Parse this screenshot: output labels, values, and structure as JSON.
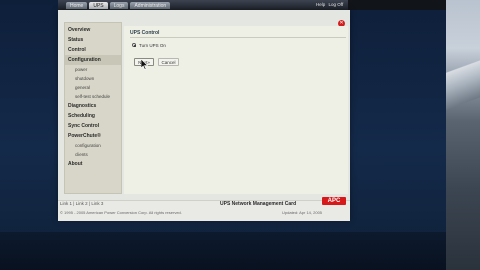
{
  "topnav": {
    "tabs": [
      "Home",
      "UPS",
      "Logs",
      "Administration"
    ],
    "active_index": 1,
    "help_links": [
      "Help",
      "Log Off"
    ]
  },
  "sidebar": {
    "items": [
      {
        "label": "Overview",
        "sub": false
      },
      {
        "label": "Status",
        "sub": false
      },
      {
        "label": "Control",
        "sub": false
      },
      {
        "label": "Configuration",
        "sub": false
      },
      {
        "label": "power",
        "sub": true
      },
      {
        "label": "shutdown",
        "sub": true
      },
      {
        "label": "general",
        "sub": true
      },
      {
        "label": "self-test schedule",
        "sub": true
      },
      {
        "label": "Diagnostics",
        "sub": false
      },
      {
        "label": "Scheduling",
        "sub": false
      },
      {
        "label": "Sync Control",
        "sub": false
      },
      {
        "label": "PowerChute®",
        "sub": false
      },
      {
        "label": "configuration",
        "sub": true
      },
      {
        "label": "clients",
        "sub": true
      },
      {
        "label": "About",
        "sub": false
      }
    ]
  },
  "panel": {
    "title": "UPS Control",
    "option_label": "Turn UPS On",
    "apply_label": "Next»",
    "cancel_label": "Cancel"
  },
  "footer": {
    "links": "Link 1 | Link 2 | Link 3",
    "card_title": "UPS Network Management Card",
    "brand": "APC",
    "copyright": "© 1995 - 2005 American Power Conversion Corp. All rights reserved.",
    "refresh": "Updated: Apr 14, 2005"
  },
  "colors": {
    "brand_red": "#d7191b",
    "close_red": "#d11f1f",
    "sidebar_bg": "#d8d6c8",
    "content_bg": "#eef0e6"
  },
  "icons": [
    "close-icon",
    "mouse-cursor-icon"
  ]
}
